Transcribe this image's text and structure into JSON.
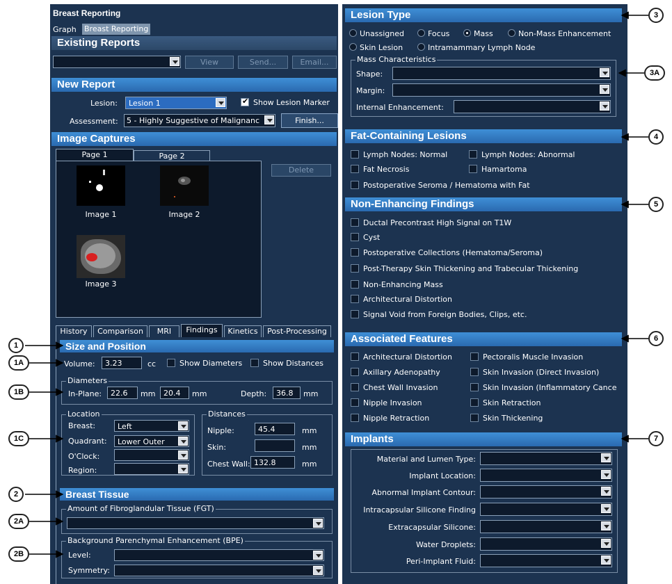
{
  "left": {
    "app_title": "Breast Reporting",
    "tabs": [
      "Graph",
      "Breast Reporting"
    ],
    "existing_reports": "Existing Reports",
    "buttons": {
      "view": "View",
      "send": "Send...",
      "email": "Email...",
      "finish": "Finish...",
      "delete": "Delete"
    },
    "new_report": "New Report",
    "lesion_label": "Lesion:",
    "lesion_value": "Lesion 1",
    "show_markers": "Show Lesion Marker",
    "assessment_label": "Assessment:",
    "assessment_value": "5 - Highly Suggestive of Malignanc",
    "image_captures": "Image Captures",
    "pages": [
      "Page 1",
      "Page 2"
    ],
    "images": [
      "Image 1",
      "Image 2",
      "Image 3"
    ],
    "bottom_tabs": [
      "History",
      "Comparison",
      "MRI",
      "Findings",
      "Kinetics",
      "Post-Processing"
    ],
    "size_position": "Size and Position",
    "volume_label": "Volume:",
    "volume_value": "3.23",
    "volume_unit": "cc",
    "show_diameters": "Show Diameters",
    "show_distances": "Show Distances",
    "diameters_title": "Diameters",
    "inplane_label": "In-Plane:",
    "inplane1": "22.6",
    "inplane2": "20.4",
    "mm": "mm",
    "depth_label": "Depth:",
    "depth_value": "36.8",
    "location_title": "Location",
    "breast_label": "Breast:",
    "breast_value": "Left",
    "quadrant_label": "Quadrant:",
    "quadrant_value": "Lower Outer",
    "oclock_label": "O'Clock:",
    "region_label": "Region:",
    "distances_title": "Distances",
    "nipple_label": "Nipple:",
    "nipple_value": "45.4",
    "skin_label": "Skin:",
    "skin_value": "",
    "chestwall_label": "Chest Wall:",
    "chestwall_value": "132.8",
    "breast_tissue": "Breast Tissue",
    "fgt_title": "Amount of Fibroglandular Tissue (FGT)",
    "bpe_title": "Background Parenchymal Enhancement (BPE)",
    "level_label": "Level:",
    "symmetry_label": "Symmetry:"
  },
  "right": {
    "lesion_type": "Lesion Type",
    "radios": [
      "Unassigned",
      "Focus",
      "Mass",
      "Non-Mass Enhancement",
      "Skin Lesion",
      "Intramammary Lymph Node"
    ],
    "selected_radio": "Mass",
    "mass_title": "Mass Characteristics",
    "shape_label": "Shape:",
    "margin_label": "Margin:",
    "internal_label": "Internal Enhancement:",
    "fat_title": "Fat-Containing Lesions",
    "fat_items": [
      "Lymph Nodes: Normal",
      "Lymph Nodes: Abnormal",
      "Fat Necrosis",
      "Hamartoma",
      "Postoperative Seroma / Hematoma with Fat"
    ],
    "nonenh_title": "Non-Enhancing Findings",
    "nonenh_items": [
      "Ductal Precontrast High Signal on T1W",
      "Cyst",
      "Postoperative Collections (Hematoma/Seroma)",
      "Post-Therapy Skin Thickening and Trabecular Thickening",
      "Non-Enhancing Mass",
      "Architectural Distortion",
      "Signal Void from Foreign Bodies, Clips, etc."
    ],
    "assoc_title": "Associated Features",
    "assoc_items": [
      "Architectural Distortion",
      "Pectoralis Muscle Invasion",
      "Axillary Adenopathy",
      "Skin Invasion (Direct Invasion)",
      "Chest Wall Invasion",
      "Skin Invasion (Inflammatory Cance",
      "Nipple Invasion",
      "Skin Retraction",
      "Nipple Retraction",
      "Skin Thickening"
    ],
    "implants_title": "Implants",
    "implant_items": [
      "Material and Lumen Type:",
      "Implant Location:",
      "Abnormal Implant Contour:",
      "Intracapsular Silicone Finding",
      "Extracapsular Silicone:",
      "Water Droplets:",
      "Peri-Implant Fluid:"
    ]
  },
  "callouts": {
    "c1": "1",
    "c1a": "1A",
    "c1b": "1B",
    "c1c": "1C",
    "c2": "2",
    "c2a": "2A",
    "c2b": "2B",
    "c3": "3",
    "c3a": "3A",
    "c4": "4",
    "c5": "5",
    "c6": "6",
    "c7": "7"
  }
}
